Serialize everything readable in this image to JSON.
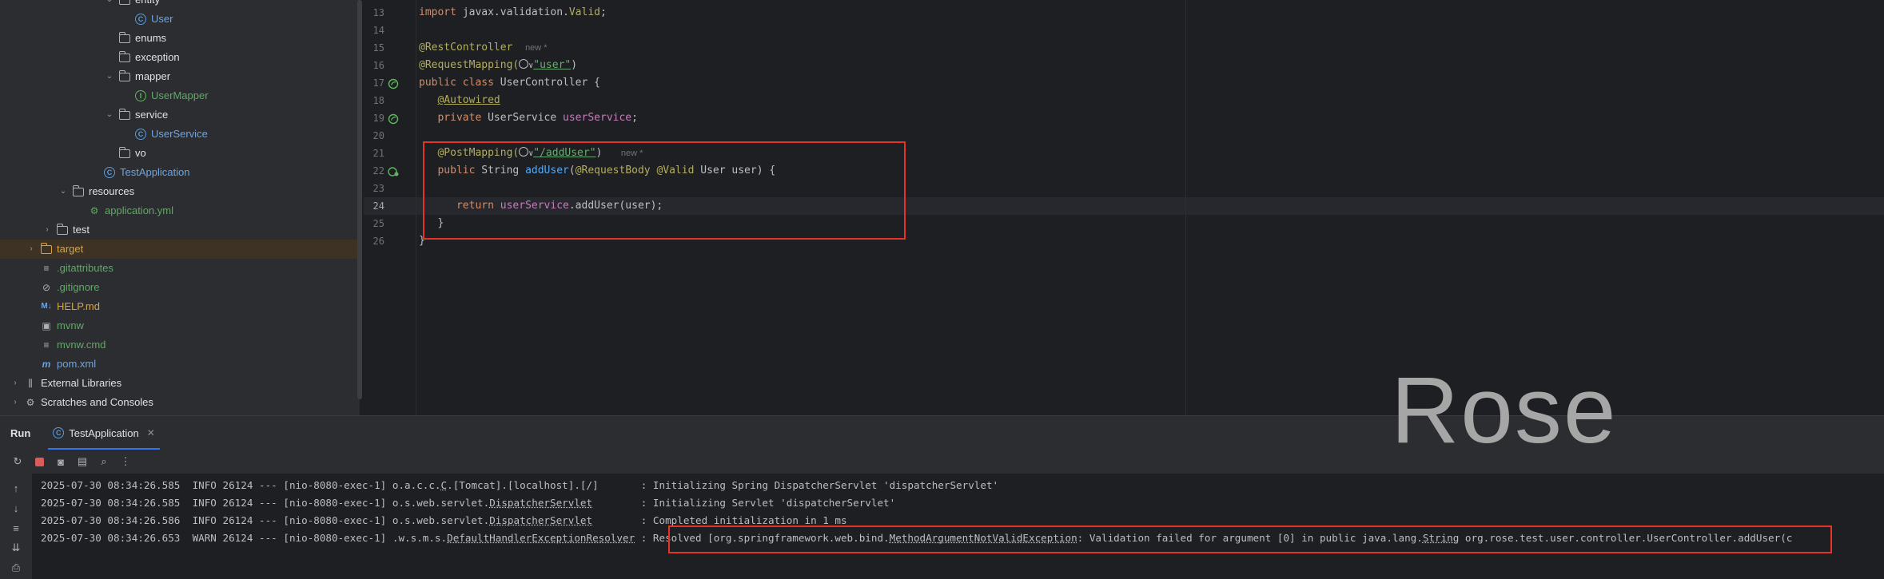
{
  "project_tree": [
    {
      "label": "entity",
      "kind": "folder",
      "indent": 2,
      "expanded": true
    },
    {
      "label": "User",
      "kind": "class",
      "indent": 3
    },
    {
      "label": "enums",
      "kind": "folder",
      "indent": 2
    },
    {
      "label": "exception",
      "kind": "folder",
      "indent": 2
    },
    {
      "label": "mapper",
      "kind": "folder",
      "indent": 2,
      "expanded": true
    },
    {
      "label": "UserMapper",
      "kind": "interface",
      "indent": 3
    },
    {
      "label": "service",
      "kind": "folder",
      "indent": 2,
      "expanded": true
    },
    {
      "label": "UserService",
      "kind": "class",
      "indent": 3
    },
    {
      "label": "vo",
      "kind": "folder",
      "indent": 2
    },
    {
      "label": "TestApplication",
      "kind": "class",
      "indent": 1
    },
    {
      "label": "resources",
      "kind": "folder",
      "indent": 0,
      "expanded": true
    },
    {
      "label": "application.yml",
      "kind": "yml",
      "indent": 1
    },
    {
      "label": "test",
      "kind": "folder",
      "indent": -1
    },
    {
      "label": "target",
      "kind": "folder-orange",
      "indent": -2
    },
    {
      "label": ".gitattributes",
      "kind": "file",
      "indent": -2
    },
    {
      "label": ".gitignore",
      "kind": "file",
      "indent": -2
    },
    {
      "label": "HELP.md",
      "kind": "md",
      "indent": -2
    },
    {
      "label": "mvnw",
      "kind": "file",
      "indent": -2
    },
    {
      "label": "mvnw.cmd",
      "kind": "file",
      "indent": -2
    },
    {
      "label": "pom.xml",
      "kind": "maven",
      "indent": -2
    },
    {
      "label": "External Libraries",
      "kind": "lib",
      "indent": -3
    },
    {
      "label": "Scratches and Consoles",
      "kind": "scratch",
      "indent": -3
    }
  ],
  "editor": {
    "line_numbers": [
      "13",
      "14",
      "15",
      "16",
      "17",
      "18",
      "19",
      "20",
      "21",
      "22",
      "23",
      "24",
      "25",
      "26"
    ],
    "current_line": "24",
    "code": {
      "l13_kw": "import",
      "l13_rest": " javax.validation.",
      "l13_ann": "Valid",
      "l13_end": ";",
      "l15_ann": "@RestController",
      "l15_hint": "new *",
      "l16_ann": "@RequestMapping(",
      "l16_icons": "∨",
      "l16_str": "\"user\"",
      "l16_end": ")",
      "l17_kw": "public class",
      "l17_rest": " UserController {",
      "l18_ann": "@Autowired",
      "l19_kw": "private",
      "l19_type": " UserService ",
      "l19_fld": "userService",
      "l19_end": ";",
      "l21_ann": "@PostMapping(",
      "l21_icons": "∨",
      "l21_str": "\"/addUser\"",
      "l21_end": ")",
      "l21_hint": "new *",
      "l22_kw": "public",
      "l22_type": " String ",
      "l22_fn": "addUser",
      "l22_ann1": "@RequestBody",
      "l22_ann2": "@Valid",
      "l22_rest": " User user) {",
      "l24_kw": "return",
      "l24_fld": "userService",
      "l24_rest": ".addUser(user);",
      "l25": "}",
      "l26": "}"
    }
  },
  "run_panel": {
    "title": "Run",
    "tab_label": "TestApplication",
    "logs": [
      {
        "ts": "2025-07-30 08:34:26.585",
        "level": "INFO",
        "pid": "26124",
        "sep": "---",
        "thread": "[nio-8080-exec-1]",
        "logger_pre": "o.a.c.c.",
        "logger_link": "C",
        "logger_post": ".[Tomcat].[localhost].[/]      ",
        "msg": ": Initializing Spring DispatcherServlet 'dispatcherServlet'"
      },
      {
        "ts": "2025-07-30 08:34:26.585",
        "level": "INFO",
        "pid": "26124",
        "sep": "---",
        "thread": "[nio-8080-exec-1]",
        "logger_pre": "o.s.web.servlet.",
        "logger_link": "DispatcherServlet",
        "logger_post": "       ",
        "msg": ": Initializing Servlet 'dispatcherServlet'"
      },
      {
        "ts": "2025-07-30 08:34:26.586",
        "level": "INFO",
        "pid": "26124",
        "sep": "---",
        "thread": "[nio-8080-exec-1]",
        "logger_pre": "o.s.web.servlet.",
        "logger_link": "DispatcherServlet",
        "logger_post": "       ",
        "msg": ": Completed initialization in 1 ms"
      },
      {
        "ts": "2025-07-30 08:34:26.653",
        "level": "WARN",
        "pid": "26124",
        "sep": "---",
        "thread": "[nio-8080-exec-1]",
        "logger_pre": ".w.s.m.s.",
        "logger_link": "DefaultHandlerExceptionResolver",
        "logger_post": "",
        "msg_pre": " : Resolved [org.springframework.web.bind.",
        "msg_link": "MethodArgumentNotValidException",
        "msg_mid": ": Validation failed for argument [0] in public java.lang.",
        "msg_link2": "String",
        "msg_post": " org.rose.test.user.controller.UserController.addUser(c"
      }
    ]
  },
  "watermark": "Rose",
  "colors": {
    "highlight_box": "#e5332a",
    "accent": "#3574f0"
  }
}
